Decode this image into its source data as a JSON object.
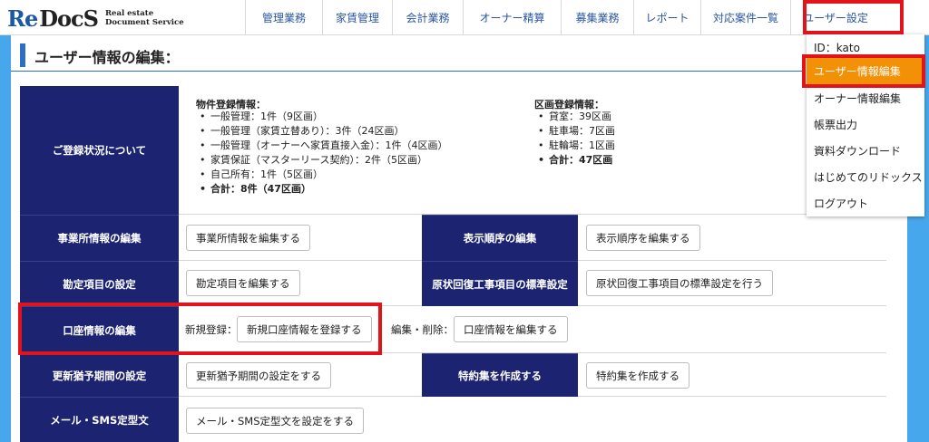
{
  "brand": {
    "re": "Re",
    "docs": "DocS",
    "tag1": "Real estate",
    "tag2": "Document Service"
  },
  "nav": [
    {
      "label": "管理業務"
    },
    {
      "label": "家賃管理"
    },
    {
      "label": "会計業務"
    },
    {
      "label": "オーナー精算"
    },
    {
      "label": "募集業務"
    },
    {
      "label": "レポート"
    },
    {
      "label": "対応案件一覧"
    },
    {
      "label": "ユーザー設定"
    }
  ],
  "page_title": "ユーザー情報の編集：",
  "registration": {
    "header": "ご登録状況について",
    "property_title": "物件登録情報：",
    "property_items": [
      "一般管理：1件（9区画）",
      "一般管理（家賃立替あり）：3件（24区画）",
      "一般管理（オーナーへ家賃直接入金）：1件（4区画）",
      "家賃保証（マスターリース契約）：2件（5区画）",
      "自己所有：1件（5区画）",
      "合計：8件（47区画）"
    ],
    "section_title": "区画登録情報：",
    "section_items": [
      "貸室：39区画",
      "駐車場：7区画",
      "駐輪場：1区画",
      "合計：47区画"
    ]
  },
  "rows": {
    "office": {
      "header": "事業所情報の編集",
      "button": "事業所情報を編集する"
    },
    "display_order": {
      "header": "表示順序の編集",
      "button": "表示順序を編集する"
    },
    "account_items": {
      "header": "勘定項目の設定",
      "button": "勘定項目を編集する"
    },
    "restoration": {
      "header": "原状回復工事項目の標準設定",
      "button": "原状回復工事項目の標準設定を行う"
    },
    "bank": {
      "header": "口座情報の編集",
      "new_label": "新規登録：",
      "new_button": "新規口座情報を登録する",
      "edit_label": "編集・削除：",
      "edit_button": "口座情報を編集する"
    },
    "renewal": {
      "header": "更新猶予期間の設定",
      "button": "更新猶予期間の設定をする"
    },
    "special": {
      "header": "特約集を作成する",
      "button": "特約集を作成する"
    },
    "mail": {
      "header": "メール・SMS定型文",
      "button": "メール・SMS定型文を設定をする"
    }
  },
  "dropdown": {
    "user_id": "ID：kato",
    "items": [
      {
        "label": "ユーザー情報編集",
        "active": true
      },
      {
        "label": "オーナー情報編集"
      },
      {
        "label": "帳票出力"
      },
      {
        "label": "資料ダウンロード"
      },
      {
        "label": "はじめてのリドックス"
      },
      {
        "label": "ログアウト"
      }
    ]
  },
  "colors": {
    "accent": "#f39106",
    "header_cell": "#1c2471",
    "highlight": "#e3131b",
    "stripe": "#46a7ec"
  }
}
